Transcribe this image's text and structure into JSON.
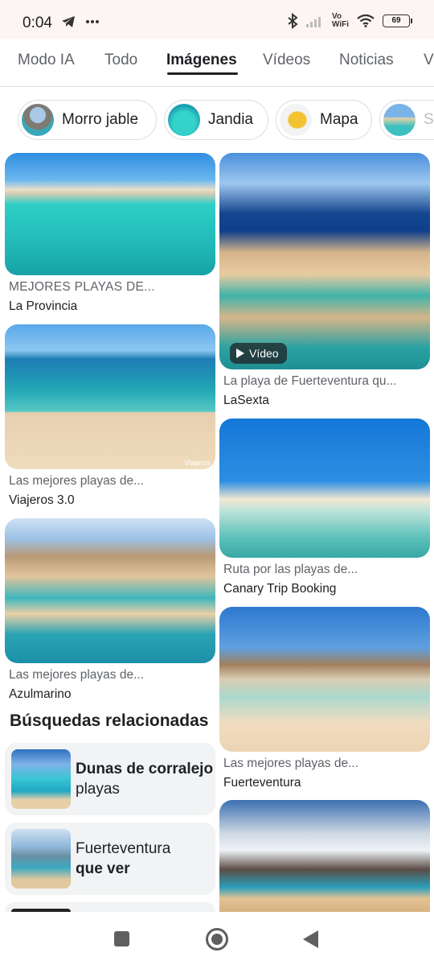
{
  "status_bar": {
    "time": "0:04",
    "battery": "69",
    "vowifi_line1": "Vo",
    "vowifi_line2": "WiFi",
    "icons": [
      "telegram-icon",
      "more-dots-icon",
      "bluetooth-icon",
      "signal-icon",
      "wifi-icon",
      "battery-icon"
    ]
  },
  "tabs": [
    {
      "label": "Modo IA",
      "active": false
    },
    {
      "label": "Todo",
      "active": false
    },
    {
      "label": "Imágenes",
      "active": true
    },
    {
      "label": "Vídeos",
      "active": false
    },
    {
      "label": "Noticias",
      "active": false
    },
    {
      "label": "V",
      "active": false
    }
  ],
  "chips": [
    {
      "label": "Morro jable"
    },
    {
      "label": "Jandia"
    },
    {
      "label": "Mapa"
    },
    {
      "label": "So"
    }
  ],
  "results_left": [
    {
      "title": "MEJORES PLAYAS DE...",
      "source": "La Provincia"
    },
    {
      "title": "Las mejores playas de...",
      "source": "Viajeros 3.0",
      "watermark": "Viajeros"
    },
    {
      "title": "Las mejores playas de...",
      "source": "Azulmarino"
    }
  ],
  "results_right": [
    {
      "title": "La playa de Fuerteventura qu...",
      "source": "LaSexta",
      "badge": "Vídeo"
    },
    {
      "title": "Ruta por las playas de...",
      "source": "Canary Trip Booking"
    },
    {
      "title": "Las mejores playas de...",
      "source": "Fuerteventura"
    }
  ],
  "related": {
    "heading": "Búsquedas relacionadas",
    "items": [
      {
        "bold_part": "Dunas de corralejo",
        "plain_part": " playas"
      },
      {
        "plain_part": "Fuerteventura",
        "bold_part": "que ver"
      }
    ]
  },
  "nav_bar": {
    "icons": [
      "recents-square-icon",
      "home-circle-icon",
      "back-triangle-icon"
    ]
  }
}
